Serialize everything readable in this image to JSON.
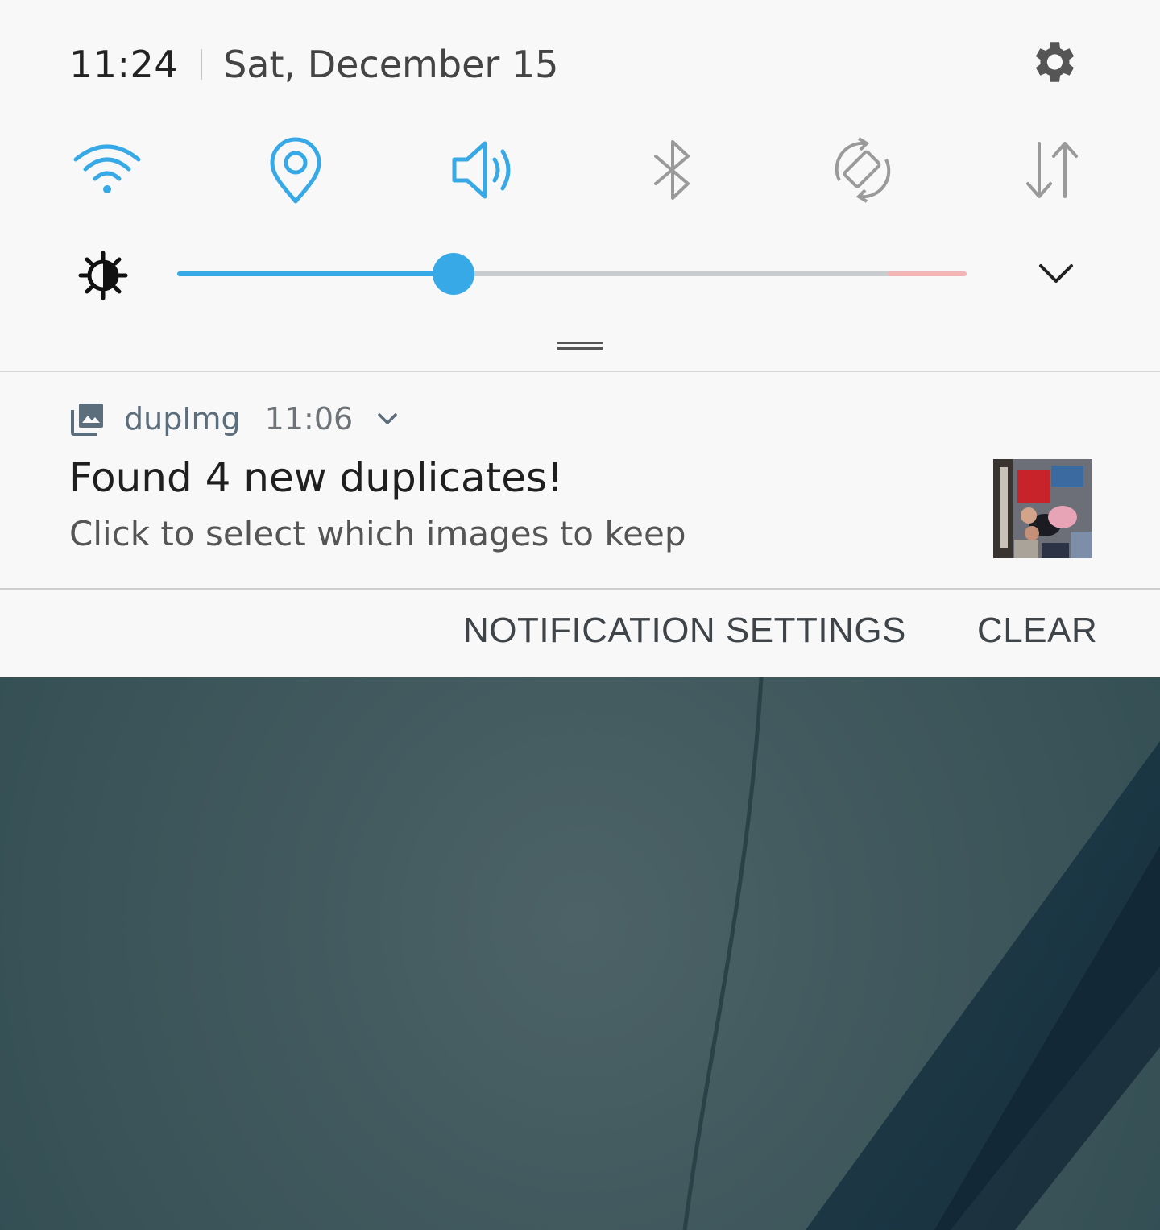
{
  "status": {
    "time": "11:24",
    "date": "Sat, December 15"
  },
  "quick_settings": {
    "active_color": "#37a9e6",
    "inactive_color": "#9a9a9a",
    "icons": [
      "wifi-icon",
      "location-icon",
      "sound-icon",
      "bluetooth-icon",
      "auto-rotate-icon",
      "mobile-data-icon"
    ],
    "states": {
      "wifi": "on",
      "location": "on",
      "sound": "on",
      "bluetooth": "off",
      "auto_rotate": "off",
      "mobile_data": "off"
    }
  },
  "brightness": {
    "level_fraction": 0.35
  },
  "notification": {
    "app_name": "dupImg",
    "time": "11:06",
    "title": "Found 4 new duplicates!",
    "text": "Click to select which images to keep"
  },
  "actions": {
    "settings_label": "NOTIFICATION SETTINGS",
    "clear_label": "CLEAR"
  }
}
